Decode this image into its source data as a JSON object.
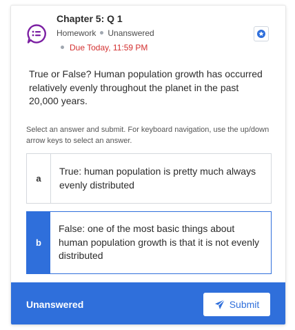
{
  "header": {
    "title": "Chapter 5: Q 1",
    "type": "Homework",
    "status": "Unanswered",
    "due": "Due Today, 11:59 PM"
  },
  "question": {
    "text": "True or False? Human population growth has occurred relatively evenly throughout the planet in the past 20,000 years."
  },
  "instructions": "Select an answer and submit. For keyboard navigation, use the up/down arrow keys to select an answer.",
  "options": [
    {
      "letter": "a",
      "text": "True: human population is pretty much always evenly distributed",
      "selected": false
    },
    {
      "letter": "b",
      "text": "False: one of the most basic things about human population growth is that it is not evenly distributed",
      "selected": true
    }
  ],
  "footer": {
    "status": "Unanswered",
    "submit_label": "Submit"
  },
  "colors": {
    "accent": "#2f6fdb",
    "icon_purple": "#7b1fa2",
    "due_red": "#d32f2f"
  },
  "icons": [
    "chat-list-icon",
    "star-icon",
    "send-icon"
  ]
}
